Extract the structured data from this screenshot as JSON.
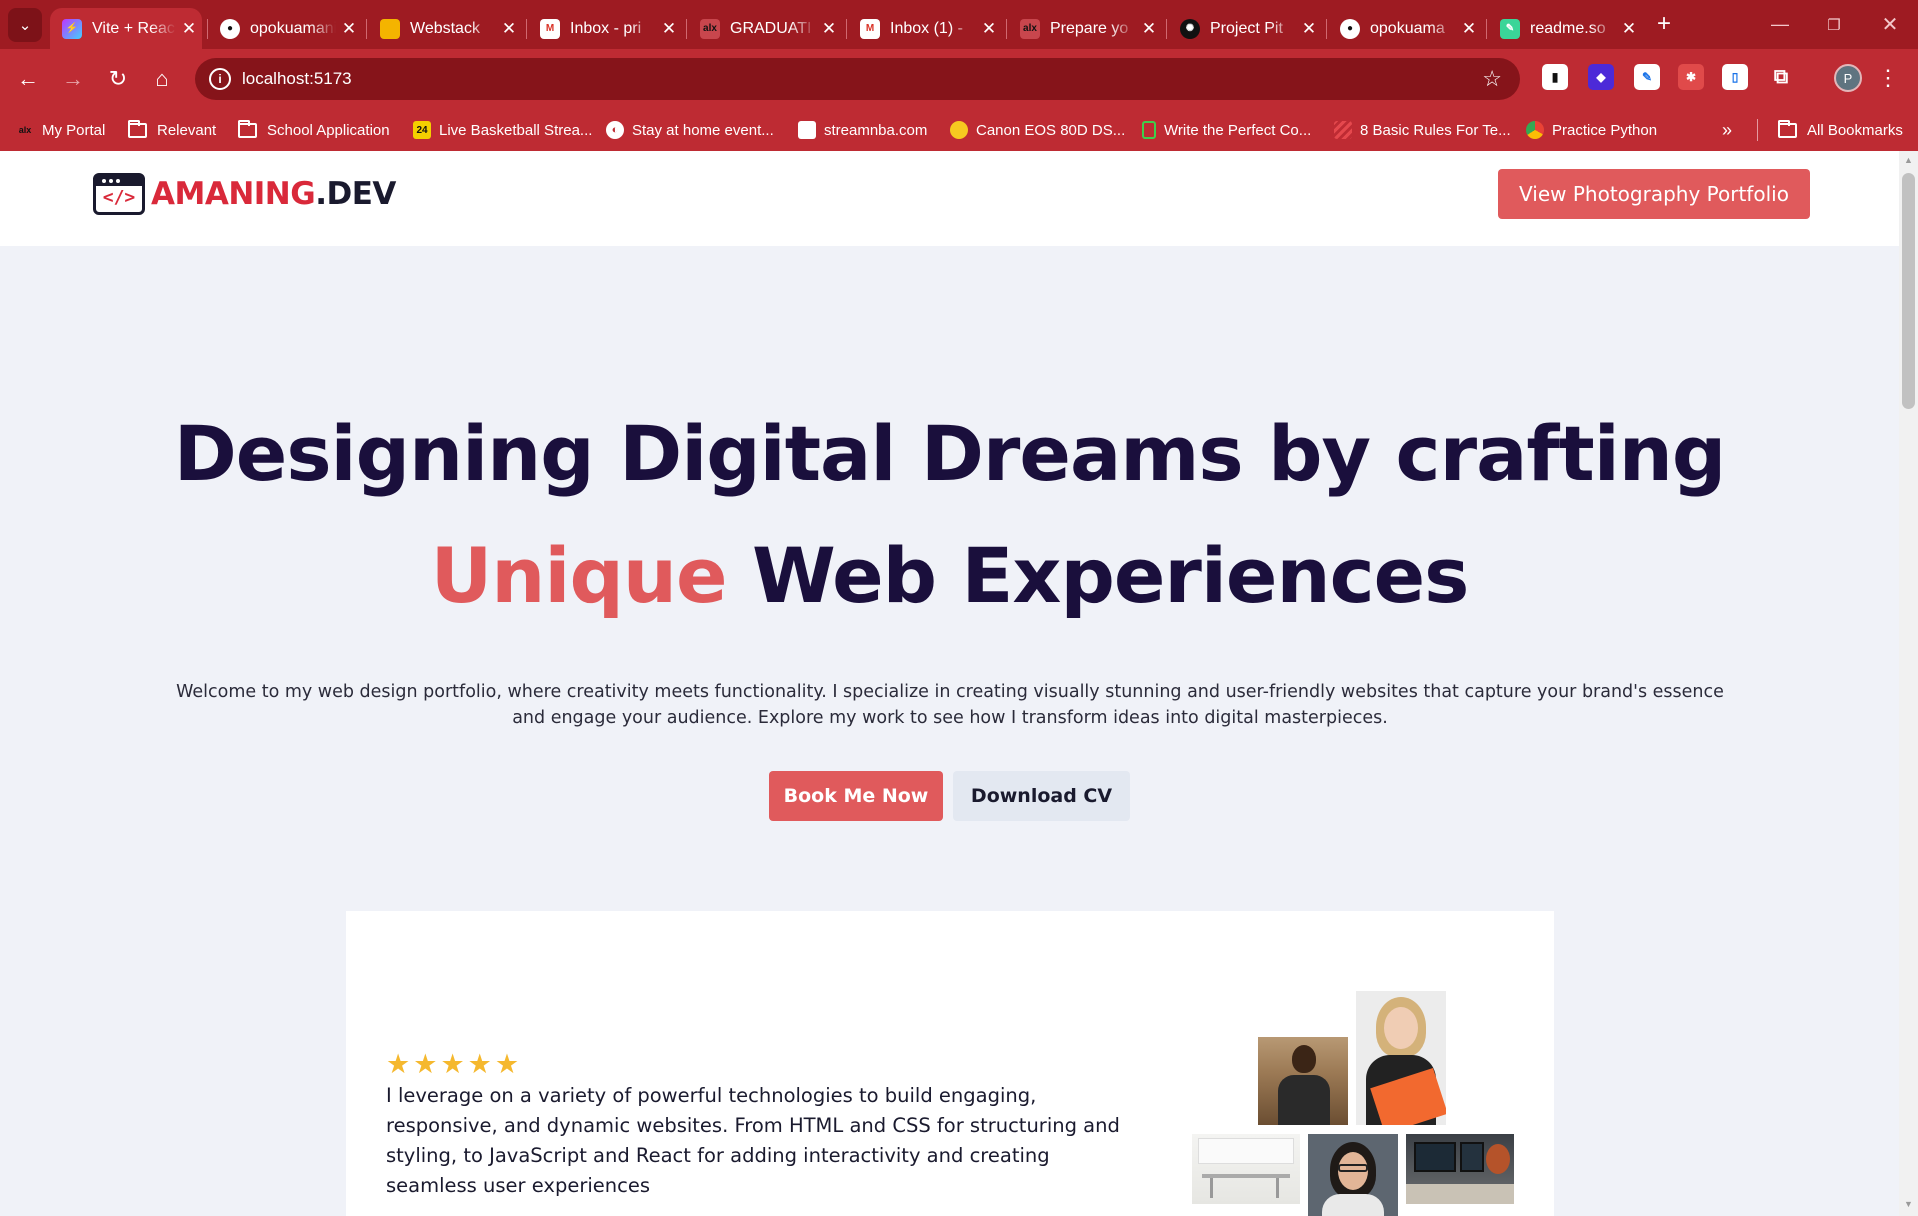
{
  "browser": {
    "tabs": [
      {
        "label": "Vite + React + TS",
        "icon": "vite-icon",
        "active": true
      },
      {
        "label": "opokuamaning",
        "icon": "github-icon"
      },
      {
        "label": "Webstack",
        "icon": "slides-icon"
      },
      {
        "label": "Inbox - pri",
        "icon": "gmail-icon"
      },
      {
        "label": "GRADUATI",
        "icon": "alx-icon"
      },
      {
        "label": "Inbox (1) -",
        "icon": "gmail-icon"
      },
      {
        "label": "Prepare yo",
        "icon": "alx-icon"
      },
      {
        "label": "Project Pit",
        "icon": "openai-icon"
      },
      {
        "label": "opokuama",
        "icon": "github-icon"
      },
      {
        "label": "readme.so",
        "icon": "readme-icon"
      }
    ],
    "url": "localhost:5173",
    "avatar_letter": "P",
    "bookmarks": [
      {
        "label": "My Portal",
        "icon": "alx-icon"
      },
      {
        "label": "Relevant",
        "icon": "folder-icon"
      },
      {
        "label": "School Application",
        "icon": "folder-icon"
      },
      {
        "label": "Live Basketball Strea...",
        "icon": "stream24-icon"
      },
      {
        "label": "Stay at home event...",
        "icon": "globe-icon"
      },
      {
        "label": "streamnba.com",
        "icon": "page-icon"
      },
      {
        "label": "Canon EOS 80D DS...",
        "icon": "canon-icon"
      },
      {
        "label": "Write the Perfect Co...",
        "icon": "doc-icon"
      },
      {
        "label": "8 Basic Rules For Te...",
        "icon": "stripes-icon"
      },
      {
        "label": "Practice Python",
        "icon": "chrome-icon"
      }
    ],
    "all_bookmarks": "All Bookmarks"
  },
  "header": {
    "logo_main": "AMANING",
    "logo_dev": ".DEV",
    "logo_code": "</>",
    "photography_button": "View Photography Portfolio"
  },
  "hero": {
    "line1": "Designing Digital Dreams by crafting",
    "accent_word": "Unique",
    "line2_rest": " Web Experiences",
    "intro": "Welcome to my web design portfolio, where creativity meets functionality. I specialize in creating visually stunning and user-friendly websites that capture your brand's essence and engage your audience. Explore my work to see how I transform ideas into digital masterpieces.",
    "book_button": "Book Me Now",
    "cv_button": "Download CV"
  },
  "about_card": {
    "rating": 5,
    "star_glyph": "★",
    "text": "I leverage on a variety of powerful technologies to build engaging, responsive, and dynamic websites. From HTML and CSS for structuring and styling, to JavaScript and React for adding interactivity and creating seamless user experiences"
  },
  "colors": {
    "accent": "#e05a5c",
    "heading": "#1a0f3c",
    "browser_frame": "#be2b33",
    "star": "#f5b82e"
  }
}
